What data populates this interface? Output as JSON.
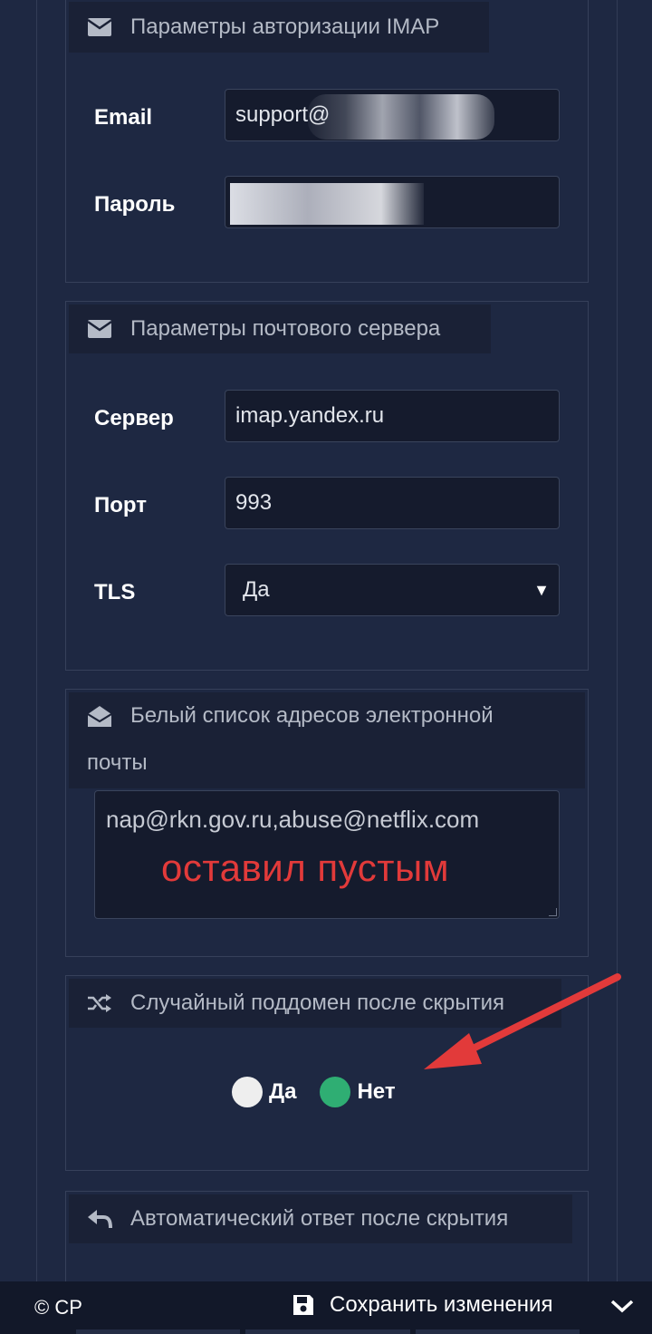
{
  "imap_auth": {
    "title": "Параметры авторизации IMAP",
    "email_label": "Email",
    "email_value": "support@",
    "password_label": "Пароль",
    "password_value": ""
  },
  "mail_server": {
    "title": "Параметры почтового сервера",
    "server_label": "Сервер",
    "server_value": "imap.yandex.ru",
    "port_label": "Порт",
    "port_value": "993",
    "tls_label": "TLS",
    "tls_value": "Да"
  },
  "whitelist": {
    "title_line1": "Белый список адресов электронной",
    "title_line2": "почты",
    "value": "nap@rkn.gov.ru,abuse@netflix.com",
    "overlay_note": "оставил пустым"
  },
  "random_subdomain": {
    "title": "Случайный поддомен после скрытия",
    "option_yes": "Да",
    "option_no": "Нет",
    "selected": "Нет"
  },
  "auto_reply": {
    "title": "Автоматический ответ после скрытия"
  },
  "footer": {
    "copyright": "© CP",
    "save_label": "Сохранить изменения"
  },
  "colors": {
    "background": "#1e2842",
    "header_bg": "#1a2136",
    "input_bg": "#151b2d",
    "radio_selected": "#2fae73",
    "radio_unselected": "#eeeeee",
    "annotation_red": "#e23a3a"
  }
}
